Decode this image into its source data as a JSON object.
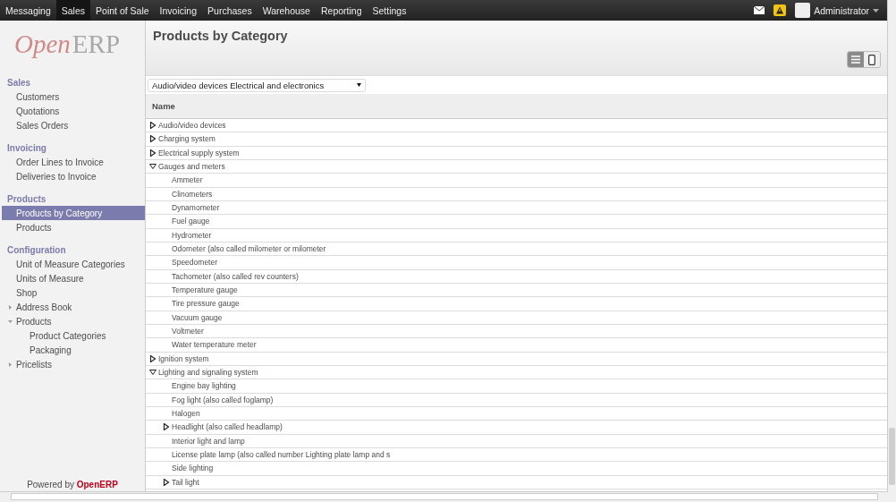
{
  "menu": [
    {
      "label": "Messaging",
      "selected": false
    },
    {
      "label": "Sales",
      "selected": true
    },
    {
      "label": "Point of Sale",
      "selected": false
    },
    {
      "label": "Invoicing",
      "selected": false
    },
    {
      "label": "Purchases",
      "selected": false
    },
    {
      "label": "Warehouse",
      "selected": false
    },
    {
      "label": "Reporting",
      "selected": false
    },
    {
      "label": "Settings",
      "selected": false
    }
  ],
  "user": {
    "name": "Administrator"
  },
  "logo": {
    "first": "Open",
    "second": "ERP"
  },
  "sidebar": [
    {
      "title": "Sales",
      "items": [
        {
          "label": "Customers",
          "selected": false
        },
        {
          "label": "Quotations",
          "selected": false
        },
        {
          "label": "Sales Orders",
          "selected": false
        }
      ]
    },
    {
      "title": "Invoicing",
      "items": [
        {
          "label": "Order Lines to Invoice",
          "selected": false
        },
        {
          "label": "Deliveries to Invoice",
          "selected": false
        }
      ]
    },
    {
      "title": "Products",
      "items": [
        {
          "label": "Products by Category",
          "selected": true
        },
        {
          "label": "Products",
          "selected": false
        }
      ]
    },
    {
      "title": "Configuration",
      "items": [
        {
          "label": "Unit of Measure Categories",
          "selected": false
        },
        {
          "label": "Units of Measure",
          "selected": false
        },
        {
          "label": "Shop",
          "selected": false
        },
        {
          "label": "Address Book",
          "selected": false,
          "expanded": false
        },
        {
          "label": "Products",
          "selected": false,
          "expanded": true,
          "children": [
            {
              "label": "Product Categories",
              "selected": false
            },
            {
              "label": "Packaging",
              "selected": false
            }
          ]
        },
        {
          "label": "Pricelists",
          "selected": false,
          "expanded": false
        }
      ]
    }
  ],
  "footer": "Powered by **OpenERP**",
  "page": {
    "title": "Products by Category",
    "views": [
      {
        "kind": "list",
        "selected": true
      },
      {
        "kind": "kanban",
        "selected": false
      }
    ],
    "filter": {
      "value": "Audio/video devices Electrical and electronics"
    },
    "column": "Name",
    "rows": [
      {
        "label": "Audio/video devices",
        "expanded": false
      },
      {
        "label": "Charging system",
        "expanded": false
      },
      {
        "label": "Electrical supply system",
        "expanded": false
      },
      {
        "label": "Gauges and meters",
        "expanded": true,
        "children": [
          {
            "label": "Ammeter"
          },
          {
            "label": "Clinometers"
          },
          {
            "label": "Dynamometer"
          },
          {
            "label": "Fuel gauge"
          },
          {
            "label": "Hydrometer"
          },
          {
            "label": "Odometer (also called milometer or milometer"
          },
          {
            "label": "Speedometer"
          },
          {
            "label": "Tachometer (also called rev counters)"
          },
          {
            "label": "Temperature gauge"
          },
          {
            "label": "Tire pressure gauge"
          },
          {
            "label": "Vacuum gauge"
          },
          {
            "label": "Voltmeter"
          },
          {
            "label": "Water temperature meter"
          }
        ]
      },
      {
        "label": "Ignition system",
        "expanded": false
      },
      {
        "label": "Lighting and signaling system",
        "expanded": true,
        "children": [
          {
            "label": "Engine bay lighting"
          },
          {
            "label": "Fog light (also called foglamp)"
          },
          {
            "label": "Halogen"
          },
          {
            "label": "Headlight (also called headlamp)",
            "expanded": false
          },
          {
            "label": "Interior light and lamp"
          },
          {
            "label": "License plate lamp (also called number Lighting plate lamp and s"
          },
          {
            "label": "Side lighting"
          },
          {
            "label": "Tail light",
            "expanded": false
          }
        ]
      }
    ]
  }
}
